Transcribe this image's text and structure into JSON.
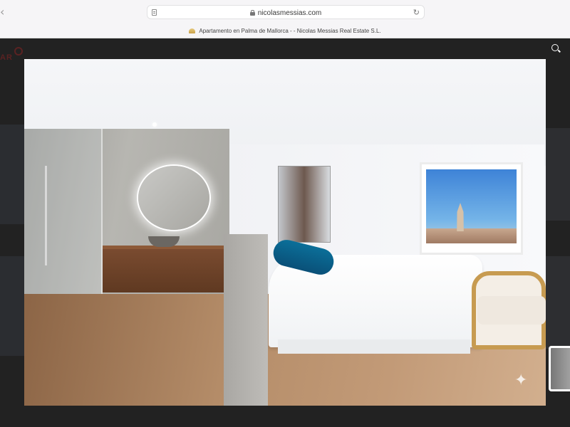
{
  "browser": {
    "url": "nicolasmessias.com",
    "tab_title": "Apartamento en Palma de Mallorca - - Nicolas Messias Real Estate S.L.",
    "back_icon": "chevron-left-icon",
    "reader_icon": "reader-icon",
    "secure_icon": "lock-icon",
    "reload_icon": "reload-icon"
  },
  "page": {
    "logo_text": "AR",
    "search_icon": "search-icon"
  },
  "lightbox": {
    "overlay_icon": "sparkle-icon",
    "thumbnail": "thumbnail-image"
  },
  "colors": {
    "chrome": "#f6f5f7",
    "page": "#1a1a1a",
    "accent": "#0a5a84"
  }
}
